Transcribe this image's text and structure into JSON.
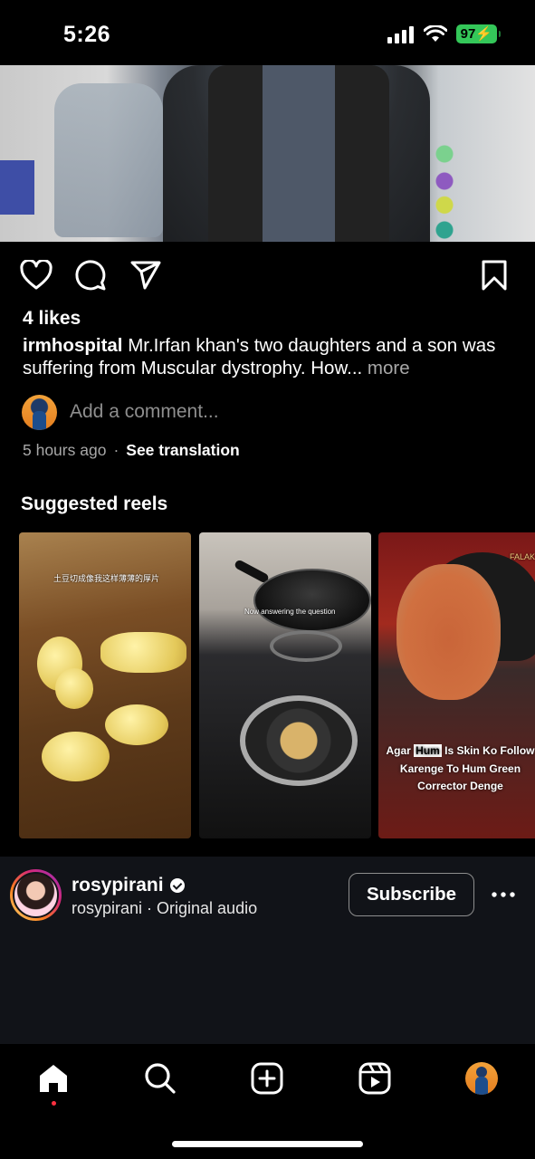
{
  "status_bar": {
    "time": "5:26",
    "battery": "97",
    "battery_color": "#34c759"
  },
  "post": {
    "likes": "4 likes",
    "username": "irmhospital",
    "caption": " Mr.Irfan khan's two daughters and a son was suffering from Muscular dystrophy. How...",
    "more": " more",
    "comment_placeholder": "Add a comment...",
    "time_ago": "5 hours ago",
    "separator": "·",
    "see_translation": "See translation"
  },
  "suggested": {
    "title": "Suggested reels",
    "reels": [
      {
        "overlay_text": "土豆切成像我这样薄薄的厚片"
      },
      {
        "overlay_text": "Now answering the question"
      },
      {
        "caption_pre": "Agar ",
        "caption_highlight": "Hum",
        "caption_post": " Is Skin Ko Follow Karenge To Hum Green Corrector Denge",
        "corner_text": "FALAK"
      }
    ]
  },
  "author": {
    "name": "rosypirani",
    "audio": "rosypirani · Original audio",
    "subscribe_label": "Subscribe"
  },
  "icons": {
    "heart": "heart-icon",
    "comment": "comment-icon",
    "share": "share-icon",
    "save": "bookmark-icon",
    "home": "home-icon",
    "search": "search-icon",
    "create": "create-icon",
    "reels": "reels-icon"
  },
  "colors": {
    "background": "#000000",
    "author_bar": "#111318",
    "secondary_text": "#a8a8a8",
    "notification_dot": "#ff3040"
  }
}
